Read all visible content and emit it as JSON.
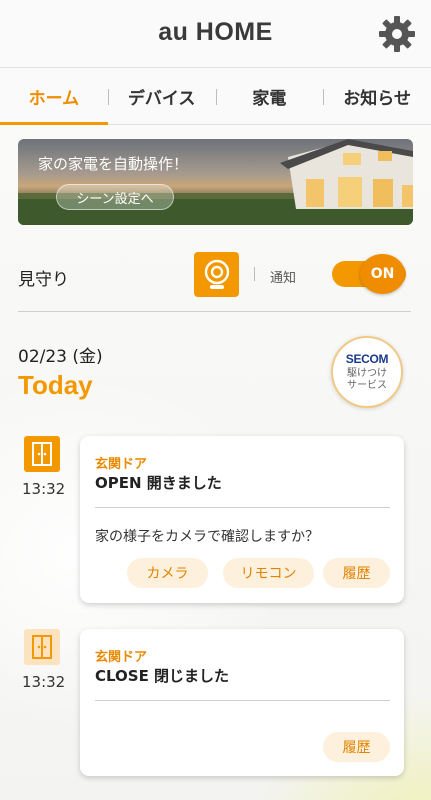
{
  "header": {
    "title": "au HOME"
  },
  "tabs": [
    {
      "label": "ホーム",
      "active": true
    },
    {
      "label": "デバイス",
      "active": false
    },
    {
      "label": "家電",
      "active": false
    },
    {
      "label": "お知らせ",
      "active": false
    }
  ],
  "banner": {
    "title": "家の家電を自動操作！",
    "button_label": "シーン設定へ"
  },
  "watch": {
    "label": "見守り",
    "notify_label": "通知",
    "toggle_label": "ON",
    "toggle_on": true
  },
  "timeline": {
    "date": "02/23 (金)",
    "today_label": "Today"
  },
  "secom": {
    "logo": "SECOM",
    "line1": "駆けつけ",
    "line2": "サービス"
  },
  "events": [
    {
      "time": "13:32",
      "source": "玄関ドア",
      "status": "OPEN 開きました",
      "question": "家の様子をカメラで確認しますか？",
      "actions": [
        "カメラ",
        "リモコン",
        "履歴"
      ]
    },
    {
      "time": "13:32",
      "source": "玄関ドア",
      "status": "CLOSE 閉じました",
      "actions": [
        "履歴"
      ]
    }
  ],
  "colors": {
    "accent": "#f39800",
    "accent_light": "#fdf0dc"
  },
  "icons": [
    "gear-icon",
    "camera-icon",
    "door-open-icon",
    "door-closed-icon"
  ]
}
